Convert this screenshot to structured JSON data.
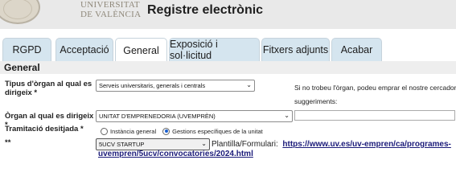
{
  "header": {
    "university_line1": "UNIVERSITAT",
    "university_line2": "DE VALÈNCIA",
    "title": "Registre electrònic"
  },
  "tabs": [
    {
      "label": "RGPD",
      "active": false
    },
    {
      "label": "Acceptació",
      "active": false
    },
    {
      "label": "General",
      "active": true
    },
    {
      "label": "Exposició i sol·licitud",
      "active": false
    },
    {
      "label": "Fitxers adjunts",
      "active": false
    },
    {
      "label": "Acabar",
      "active": false
    }
  ],
  "section_title": "General",
  "form": {
    "tipus_label": "Tipus d'òrgan al qual es dirigeix *",
    "tipus_value": "Serveis universitaris, generals i centrals",
    "note": "Si no trobeu l'òrgan, podeu emprar el nostre cercador",
    "note_suggest": "suggeriments:",
    "organ_label": "Òrgan al qual es dirigeix *",
    "organ_value": "UNITAT D'EMPRENEDORIA (UVEMPRÈN)",
    "tramitacio_label": "Tramitació desitjada *",
    "radio_general": "Instància general",
    "radio_especifica": "Gestions específiques de la unitat",
    "extra_label": "**",
    "gestio_value": "5UCV STARTUP",
    "plantilla_label": "Plantilla/Formulari:",
    "link_part1": "https://www.uv.es/uv-empren/ca/programes-",
    "link_part2": "uvempren/5ucv/convocatories/2024.html"
  },
  "colors": {
    "tab_bg": "#d5e5ef",
    "tab_active_bg": "#ffffff",
    "link": "#1c1c7a",
    "header_bg": "#e9e9e9"
  }
}
